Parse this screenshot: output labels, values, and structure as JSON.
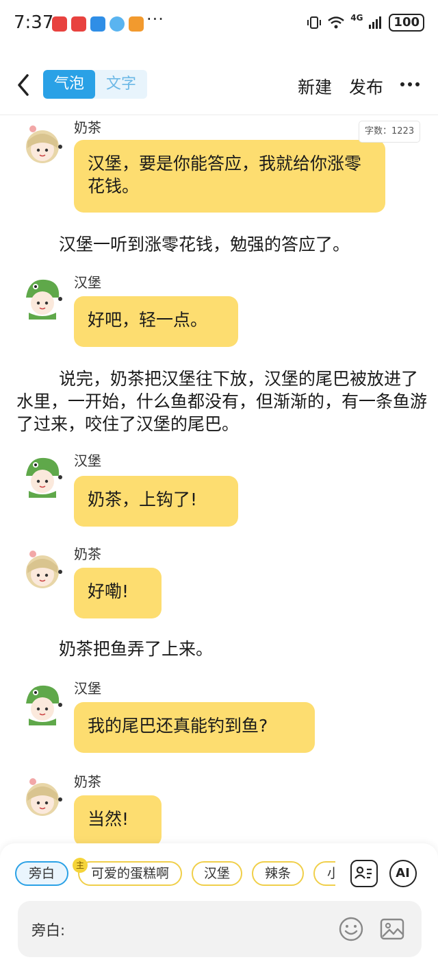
{
  "status_bar": {
    "time": "7:37",
    "network": "4G",
    "battery": "100"
  },
  "header": {
    "tabs": [
      "气泡",
      "文字"
    ],
    "active_tab": "气泡",
    "new_label": "新建",
    "publish_label": "发布"
  },
  "word_count": "字数：1223",
  "messages": [
    {
      "type": "bubble",
      "speaker": "奶茶",
      "text": "汉堡，要是你能答应，我就给你涨零花钱。"
    },
    {
      "type": "narration",
      "text": "汉堡一听到涨零花钱，勉强的答应了。"
    },
    {
      "type": "bubble",
      "speaker": "汉堡",
      "text": "好吧，轻一点。"
    },
    {
      "type": "narration",
      "text": "说完，奶茶把汉堡往下放，汉堡的尾巴被放进了水里，一开始，什么鱼都没有，但渐渐的，有一条鱼游了过来，咬住了汉堡的尾巴。"
    },
    {
      "type": "bubble",
      "speaker": "汉堡",
      "text": "奶茶，上钩了!"
    },
    {
      "type": "bubble",
      "speaker": "奶茶",
      "text": "好嘞!"
    },
    {
      "type": "narration",
      "text": "奶茶把鱼弄了上来。"
    },
    {
      "type": "bubble",
      "speaker": "汉堡",
      "text": "我的尾巴还真能钓到鱼?"
    },
    {
      "type": "bubble",
      "speaker": "奶茶",
      "text": "当然!"
    }
  ],
  "role_chips": [
    {
      "label": "旁白",
      "active": true
    },
    {
      "label": "可爱的蛋糕啊",
      "badge": "主"
    },
    {
      "label": "汉堡"
    },
    {
      "label": "辣条"
    },
    {
      "label": "小"
    }
  ],
  "ai_label": "AI",
  "input": {
    "label": "旁白:",
    "value": ""
  },
  "colors": {
    "accent": "#2aa1e6",
    "bubble": "#fddd70",
    "chip_border": "#f0cf4a"
  }
}
